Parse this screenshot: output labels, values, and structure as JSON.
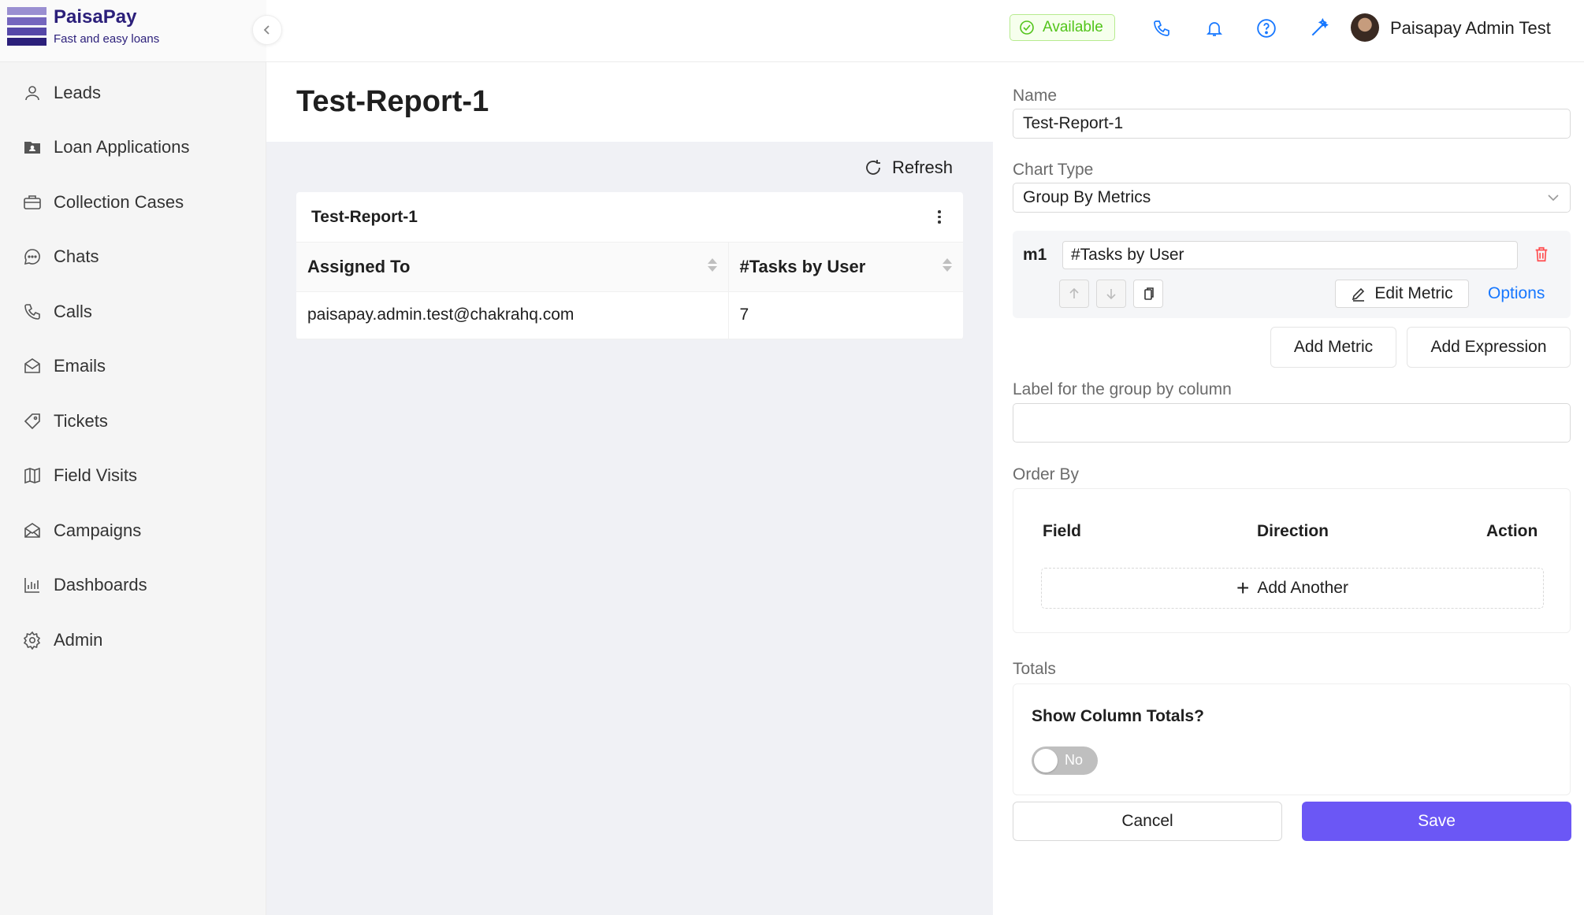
{
  "brand": {
    "name": "PaisaPay",
    "tagline": "Fast and easy loans",
    "logo_colors": [
      "#9a8fd1",
      "#7566be",
      "#5547a8",
      "#2b1f7a"
    ]
  },
  "sidebar": {
    "items": [
      {
        "label": "Leads",
        "icon": "user-icon"
      },
      {
        "label": "Loan Applications",
        "icon": "folder-user-icon"
      },
      {
        "label": "Collection Cases",
        "icon": "briefcase-icon"
      },
      {
        "label": "Chats",
        "icon": "chat-icon"
      },
      {
        "label": "Calls",
        "icon": "phone-icon"
      },
      {
        "label": "Emails",
        "icon": "mail-open-icon"
      },
      {
        "label": "Tickets",
        "icon": "tag-icon"
      },
      {
        "label": "Field Visits",
        "icon": "map-icon"
      },
      {
        "label": "Campaigns",
        "icon": "campaign-mail-icon"
      },
      {
        "label": "Dashboards",
        "icon": "bar-chart-icon"
      },
      {
        "label": "Admin",
        "icon": "gear-icon"
      }
    ]
  },
  "topbar": {
    "status": "Available",
    "user_name": "Paisapay Admin Test",
    "icons": [
      "phone-icon",
      "bell-icon",
      "help-icon",
      "magic-wand-icon"
    ],
    "accent": "#1677ff"
  },
  "report": {
    "page_title": "Test-Report-1",
    "refresh_label": "Refresh",
    "card_title": "Test-Report-1",
    "columns": [
      "Assigned To",
      "#Tasks by User"
    ],
    "rows": [
      [
        "paisapay.admin.test@chakrahq.com",
        "7"
      ]
    ]
  },
  "editor": {
    "name_label": "Name",
    "name_value": "Test-Report-1",
    "chart_type_label": "Chart Type",
    "chart_type_value": "Group By Metrics",
    "metric": {
      "tag": "m1",
      "value": "#Tasks by User",
      "edit_label": "Edit Metric",
      "options_label": "Options"
    },
    "add_metric_label": "Add Metric",
    "add_expression_label": "Add Expression",
    "group_label_title": "Label for the group by column",
    "group_label_value": "",
    "order_by_title": "Order By",
    "order_by_columns": [
      "Field",
      "Direction",
      "Action"
    ],
    "add_another_label": "Add Another",
    "totals_title": "Totals",
    "show_totals_question": "Show Column Totals?",
    "show_totals_toggle": "No",
    "cancel_label": "Cancel",
    "save_label": "Save",
    "save_color": "#6b57f5",
    "delete_color": "#ff4d4f"
  }
}
